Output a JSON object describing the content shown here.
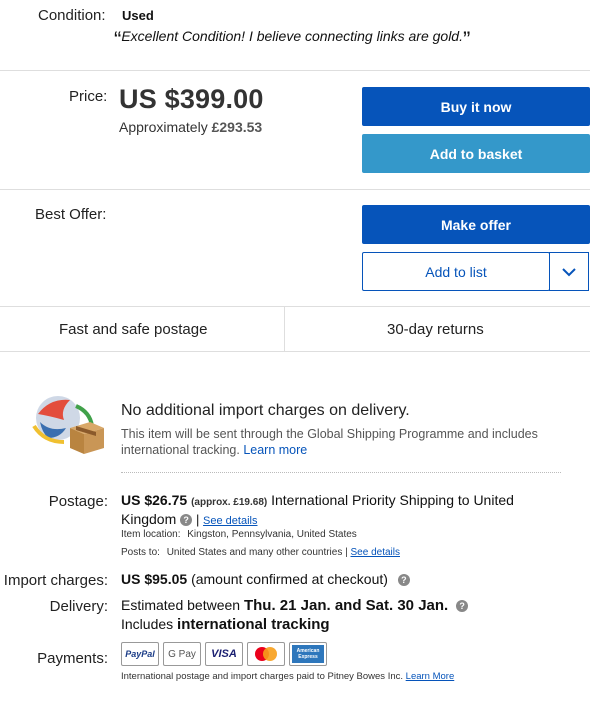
{
  "condition": {
    "label": "Condition:",
    "value": "Used",
    "open_quote": "“",
    "quote": "Excellent Condition! I believe connecting links are gold.",
    "close_quote": "”"
  },
  "price": {
    "label": "Price:",
    "value": "US $399.00",
    "approx_label": "Approximately",
    "approx_value": "£293.53"
  },
  "buttons": {
    "buy_now": "Buy it now",
    "add_to_basket": "Add to basket",
    "make_offer": "Make offer",
    "add_to_list": "Add to list"
  },
  "best_offer": {
    "label": "Best Offer:"
  },
  "features": {
    "postage": "Fast and safe postage",
    "returns": "30-day returns"
  },
  "shipping": {
    "title": "No additional import charges on delivery.",
    "description": "This item will be sent through the Global Shipping Programme and includes international tracking.",
    "learn_more": "Learn more"
  },
  "postage": {
    "label": "Postage:",
    "amount": "US $26.75",
    "approx": "(approx. £19.68)",
    "service": "International Priority Shipping to United Kingdom",
    "see_details": "See details",
    "item_location_label": "Item location:",
    "item_location": "Kingston, Pennsylvania, United States",
    "posts_to_label": "Posts to:",
    "posts_to": "United States and many other countries",
    "posts_to_details": "See details"
  },
  "import": {
    "label": "Import charges:",
    "amount": "US $95.05",
    "note": "(amount confirmed at checkout)"
  },
  "delivery": {
    "label": "Delivery:",
    "estimated_prefix": "Estimated between",
    "dates": "Thu. 21 Jan. and Sat. 30 Jan.",
    "includes_prefix": "Includes",
    "includes_bold": "international tracking"
  },
  "payments": {
    "label": "Payments:",
    "methods": [
      "PayPal",
      "G Pay",
      "VISA",
      "Mastercard",
      "American Express"
    ],
    "note": "International postage and import charges paid to Pitney Bowes Inc.",
    "learn_more": "Learn More"
  },
  "colors": {
    "primary": "#0654ba",
    "secondary": "#3498ca",
    "link": "#0654ba"
  },
  "icons": {
    "chevron": "chevron-down-icon",
    "help": "help-icon",
    "globe": "globe-package-icon"
  }
}
